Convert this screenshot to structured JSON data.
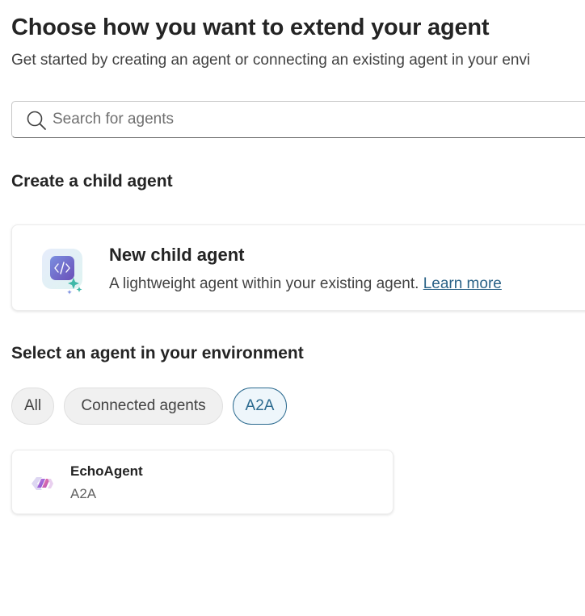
{
  "header": {
    "title": "Choose how you want to extend your agent",
    "subtitle": "Get started by creating an agent or connecting an existing agent in your envi"
  },
  "search": {
    "placeholder": "Search for agents",
    "value": "",
    "icon": "search-icon"
  },
  "create_section": {
    "heading": "Create a child agent",
    "card": {
      "title": "New child agent",
      "description": "A lightweight agent within your existing agent.",
      "link_label": "Learn more",
      "icon": "child-agent-icon"
    }
  },
  "select_section": {
    "heading": "Select an agent in your environment",
    "filters": [
      {
        "label": "All",
        "selected": false
      },
      {
        "label": "Connected agents",
        "selected": false
      },
      {
        "label": "A2A",
        "selected": true
      }
    ],
    "agents": [
      {
        "name": "EchoAgent",
        "type": "A2A",
        "icon": "echo-agent-icon"
      }
    ]
  },
  "colors": {
    "accent": "#2b6a8f",
    "link": "#2a6287",
    "chip_bg": "#f0f0f0",
    "selected_chip_bg": "#eef6fb"
  }
}
